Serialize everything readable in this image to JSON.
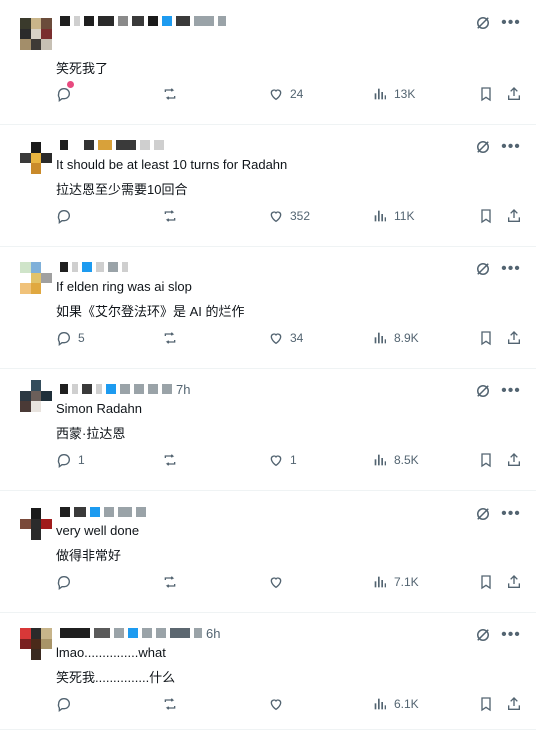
{
  "tweets": [
    {
      "header_tail": "",
      "header_overlap": "",
      "text1": "笑死我了",
      "text2": "",
      "replies": "",
      "likes": "24",
      "views": "13K",
      "show_pink_dot": true
    },
    {
      "header_tail": "",
      "header_overlap": "",
      "text1": "It should be at least 10 turns for Radahn",
      "text2": "拉达恩至少需要10回合",
      "replies": "",
      "likes": "352",
      "views": "11K"
    },
    {
      "header_tail": "",
      "header_overlap": "",
      "text1": "If elden ring was ai slop",
      "text2": "如果《艾尔登法环》是 AI 的烂作",
      "replies": "5",
      "likes": "34",
      "views": "8.9K"
    },
    {
      "header_tail": "7h",
      "header_overlap": "",
      "text1": "Simon Radahn",
      "text2": "西蒙·拉达恩",
      "replies": "1",
      "likes": "1",
      "views": "8.5K"
    },
    {
      "header_tail": "",
      "header_overlap": "",
      "text1": "very well done",
      "text2": "做得非常好",
      "replies": "",
      "likes": "",
      "views": "7.1K"
    },
    {
      "header_tail": "6h",
      "header_overlap": "",
      "text1": "lmao...............what",
      "text2": "笑死我...............什么",
      "replies": "",
      "likes": "",
      "views": "6.1K"
    }
  ],
  "icons": {
    "reply": "reply-icon",
    "retweet": "retweet-icon",
    "like": "like-icon",
    "views": "views-icon",
    "bookmark": "bookmark-icon",
    "share": "share-icon",
    "grok": "grok-icon",
    "more": "more-icon"
  },
  "colors": {
    "text": "#0f1419",
    "secondary": "#536471",
    "divider": "#eff3f4",
    "accent": "#1d9bf0",
    "pink": "#e84a7f"
  }
}
